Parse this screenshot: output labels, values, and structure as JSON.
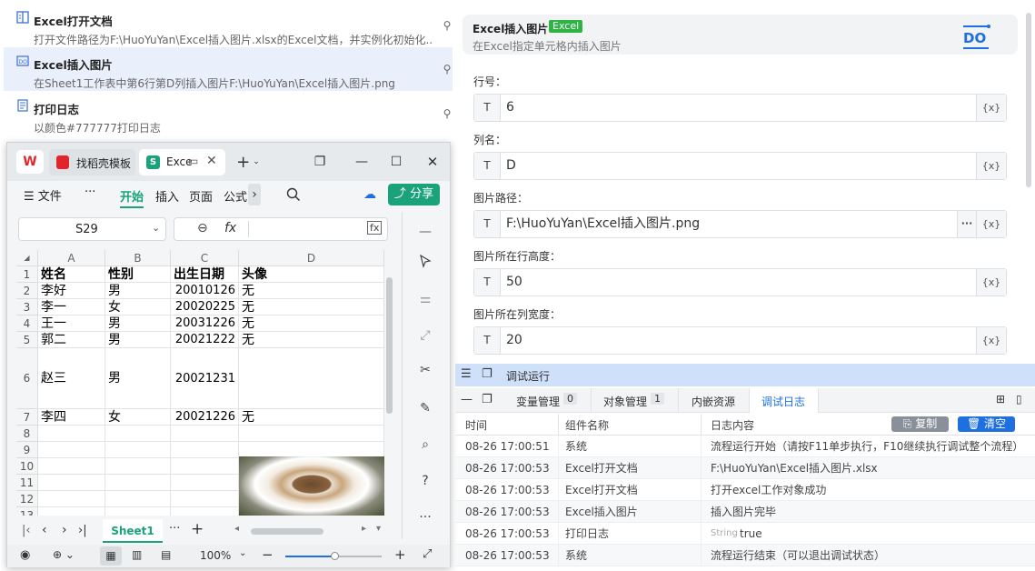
{
  "workflow": {
    "items": [
      {
        "title": "Excel打开文档",
        "desc": "打开文件路径为F:\\HuoYuYan\\Excel插入图片.xlsx的Excel文档，并实例化初始化...",
        "icon": "excel-open-icon"
      },
      {
        "title": "Excel插入图片",
        "desc": "在Sheet1工作表中第6行第D列插入图片F:\\HuoYuYan\\Excel插入图片.png",
        "icon": "excel-insert-image-icon"
      },
      {
        "title": "打印日志",
        "desc": "以颜色#777777打印日志",
        "icon": "print-log-icon"
      }
    ]
  },
  "wps": {
    "tabs": [
      {
        "label": "找稻壳模板"
      },
      {
        "label": "Exce"
      }
    ],
    "menu": {
      "file": "文件",
      "more": "···",
      "start": "开始",
      "insert": "插入",
      "page": "页面",
      "formula": "公式",
      "share": "分享"
    },
    "cell_ref": "S29",
    "fx": "fx",
    "columns": [
      "A",
      "B",
      "C",
      "D"
    ],
    "rows": [
      {
        "n": "1",
        "cells": [
          "姓名",
          "性别",
          "出生日期",
          "头像"
        ]
      },
      {
        "n": "2",
        "cells": [
          "李好",
          "男",
          "20010126",
          "无"
        ]
      },
      {
        "n": "3",
        "cells": [
          "李一",
          "女",
          "20020225",
          "无"
        ]
      },
      {
        "n": "4",
        "cells": [
          "王一",
          "男",
          "20031226",
          "无"
        ]
      },
      {
        "n": "5",
        "cells": [
          "郭二",
          "男",
          "20021222",
          "无"
        ]
      },
      {
        "n": "6",
        "cells": [
          "赵三",
          "男",
          "20021231",
          ""
        ]
      },
      {
        "n": "7",
        "cells": [
          "李四",
          "女",
          "20021226",
          "无"
        ]
      },
      {
        "n": "8",
        "cells": [
          "",
          "",
          "",
          ""
        ]
      },
      {
        "n": "9",
        "cells": [
          "",
          "",
          "",
          ""
        ]
      },
      {
        "n": "10",
        "cells": [
          "",
          "",
          "",
          ""
        ]
      },
      {
        "n": "11",
        "cells": [
          "",
          "",
          "",
          ""
        ]
      },
      {
        "n": "12",
        "cells": [
          "",
          "",
          "",
          ""
        ]
      },
      {
        "n": "13",
        "cells": [
          "",
          "",
          "",
          ""
        ]
      }
    ],
    "sheet_tab": "Sheet1",
    "zoom": "100%"
  },
  "panel": {
    "title": "Excel插入图片",
    "badge": "Excel",
    "subtitle": "在Excel指定单元格内插入图片",
    "fields": [
      {
        "label": "行号：",
        "type": "T",
        "value": "6",
        "var": "{x}"
      },
      {
        "label": "列名：",
        "type": "T",
        "value": "D",
        "var": "{x}"
      },
      {
        "label": "图片路径：",
        "type": "T",
        "value": "F:\\HuoYuYan\\Excel插入图片.png",
        "var": "{x}",
        "more": "···"
      },
      {
        "label": "图片所在行高度：",
        "type": "T",
        "value": "50",
        "var": "{x}"
      },
      {
        "label": "图片所在列宽度：",
        "type": "T",
        "value": "20",
        "var": "{x}"
      }
    ]
  },
  "debug": {
    "title": "调试运行",
    "tabs": [
      {
        "label": "变量管理",
        "count": "0"
      },
      {
        "label": "对象管理",
        "count": "1"
      },
      {
        "label": "内嵌资源",
        "count": ""
      },
      {
        "label": "调试日志",
        "count": ""
      }
    ],
    "headers": {
      "time": "时间",
      "component": "组件名称",
      "content": "日志内容"
    },
    "copy": "复制",
    "clear": "清空",
    "logs": [
      {
        "time": "08-26 17:00:51",
        "component": "系统",
        "content": "流程运行开始（请按F11单步执行，F10继续执行调试整个流程）",
        "prefix": ""
      },
      {
        "time": "08-26 17:00:53",
        "component": "Excel打开文档",
        "content": "F:\\HuoYuYan\\Excel插入图片.xlsx",
        "prefix": ""
      },
      {
        "time": "08-26 17:00:53",
        "component": "Excel打开文档",
        "content": "打开excel工作对象成功",
        "prefix": ""
      },
      {
        "time": "08-26 17:00:53",
        "component": "Excel插入图片",
        "content": "插入图片完毕",
        "prefix": ""
      },
      {
        "time": "08-26 17:00:53",
        "component": "打印日志",
        "content": "true",
        "prefix": "String"
      },
      {
        "time": "08-26 17:00:53",
        "component": "系统",
        "content": "流程运行结束（可以退出调试状态）",
        "prefix": ""
      }
    ]
  },
  "colors": {
    "accent": "#1e6fe0",
    "debug_bar": "#cfe0fb",
    "share_green": "#1aa37a",
    "excel_badge": "#2fb344"
  }
}
